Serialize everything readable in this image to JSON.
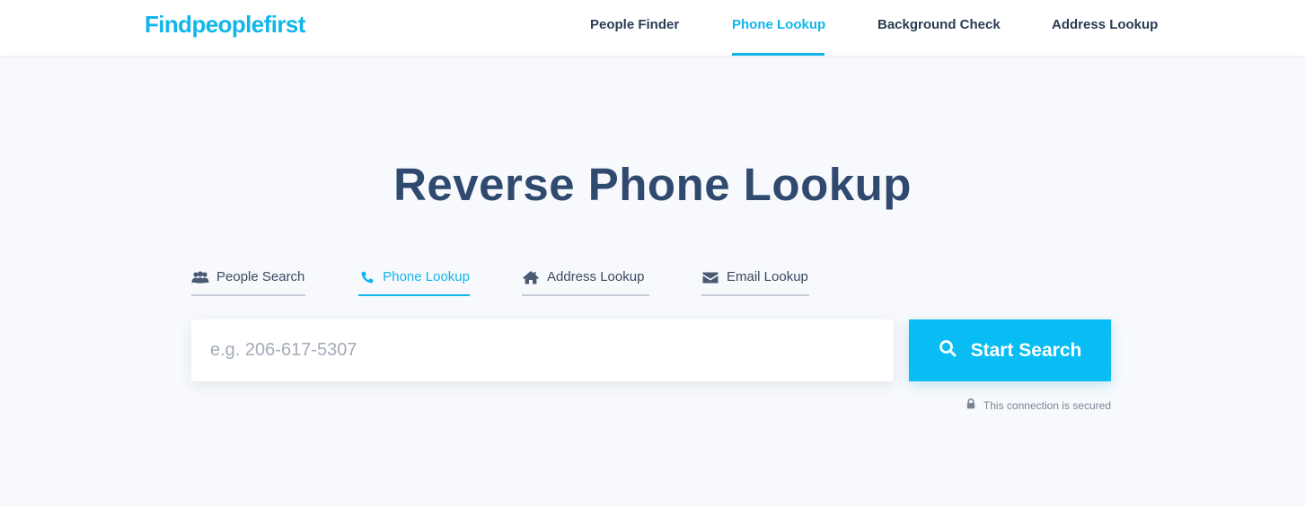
{
  "header": {
    "logo": "Findpeoplefirst",
    "nav": [
      {
        "label": "People Finder",
        "active": false
      },
      {
        "label": "Phone Lookup",
        "active": true
      },
      {
        "label": "Background Check",
        "active": false
      },
      {
        "label": "Address Lookup",
        "active": false
      }
    ]
  },
  "hero": {
    "title": "Reverse Phone Lookup"
  },
  "search_tabs": [
    {
      "label": "People Search",
      "icon": "people-icon",
      "active": false
    },
    {
      "label": "Phone Lookup",
      "icon": "phone-icon",
      "active": true
    },
    {
      "label": "Address Lookup",
      "icon": "home-icon",
      "active": false
    },
    {
      "label": "Email Lookup",
      "icon": "envelope-icon",
      "active": false
    }
  ],
  "search": {
    "placeholder": "e.g. 206-617-5307",
    "value": "",
    "button_label": "Start Search",
    "secure_note": "This connection is secured"
  },
  "colors": {
    "brand": "#12b5ea",
    "button": "#08bdf4",
    "heading": "#2f4a6e",
    "background": "#f7f9fc"
  }
}
